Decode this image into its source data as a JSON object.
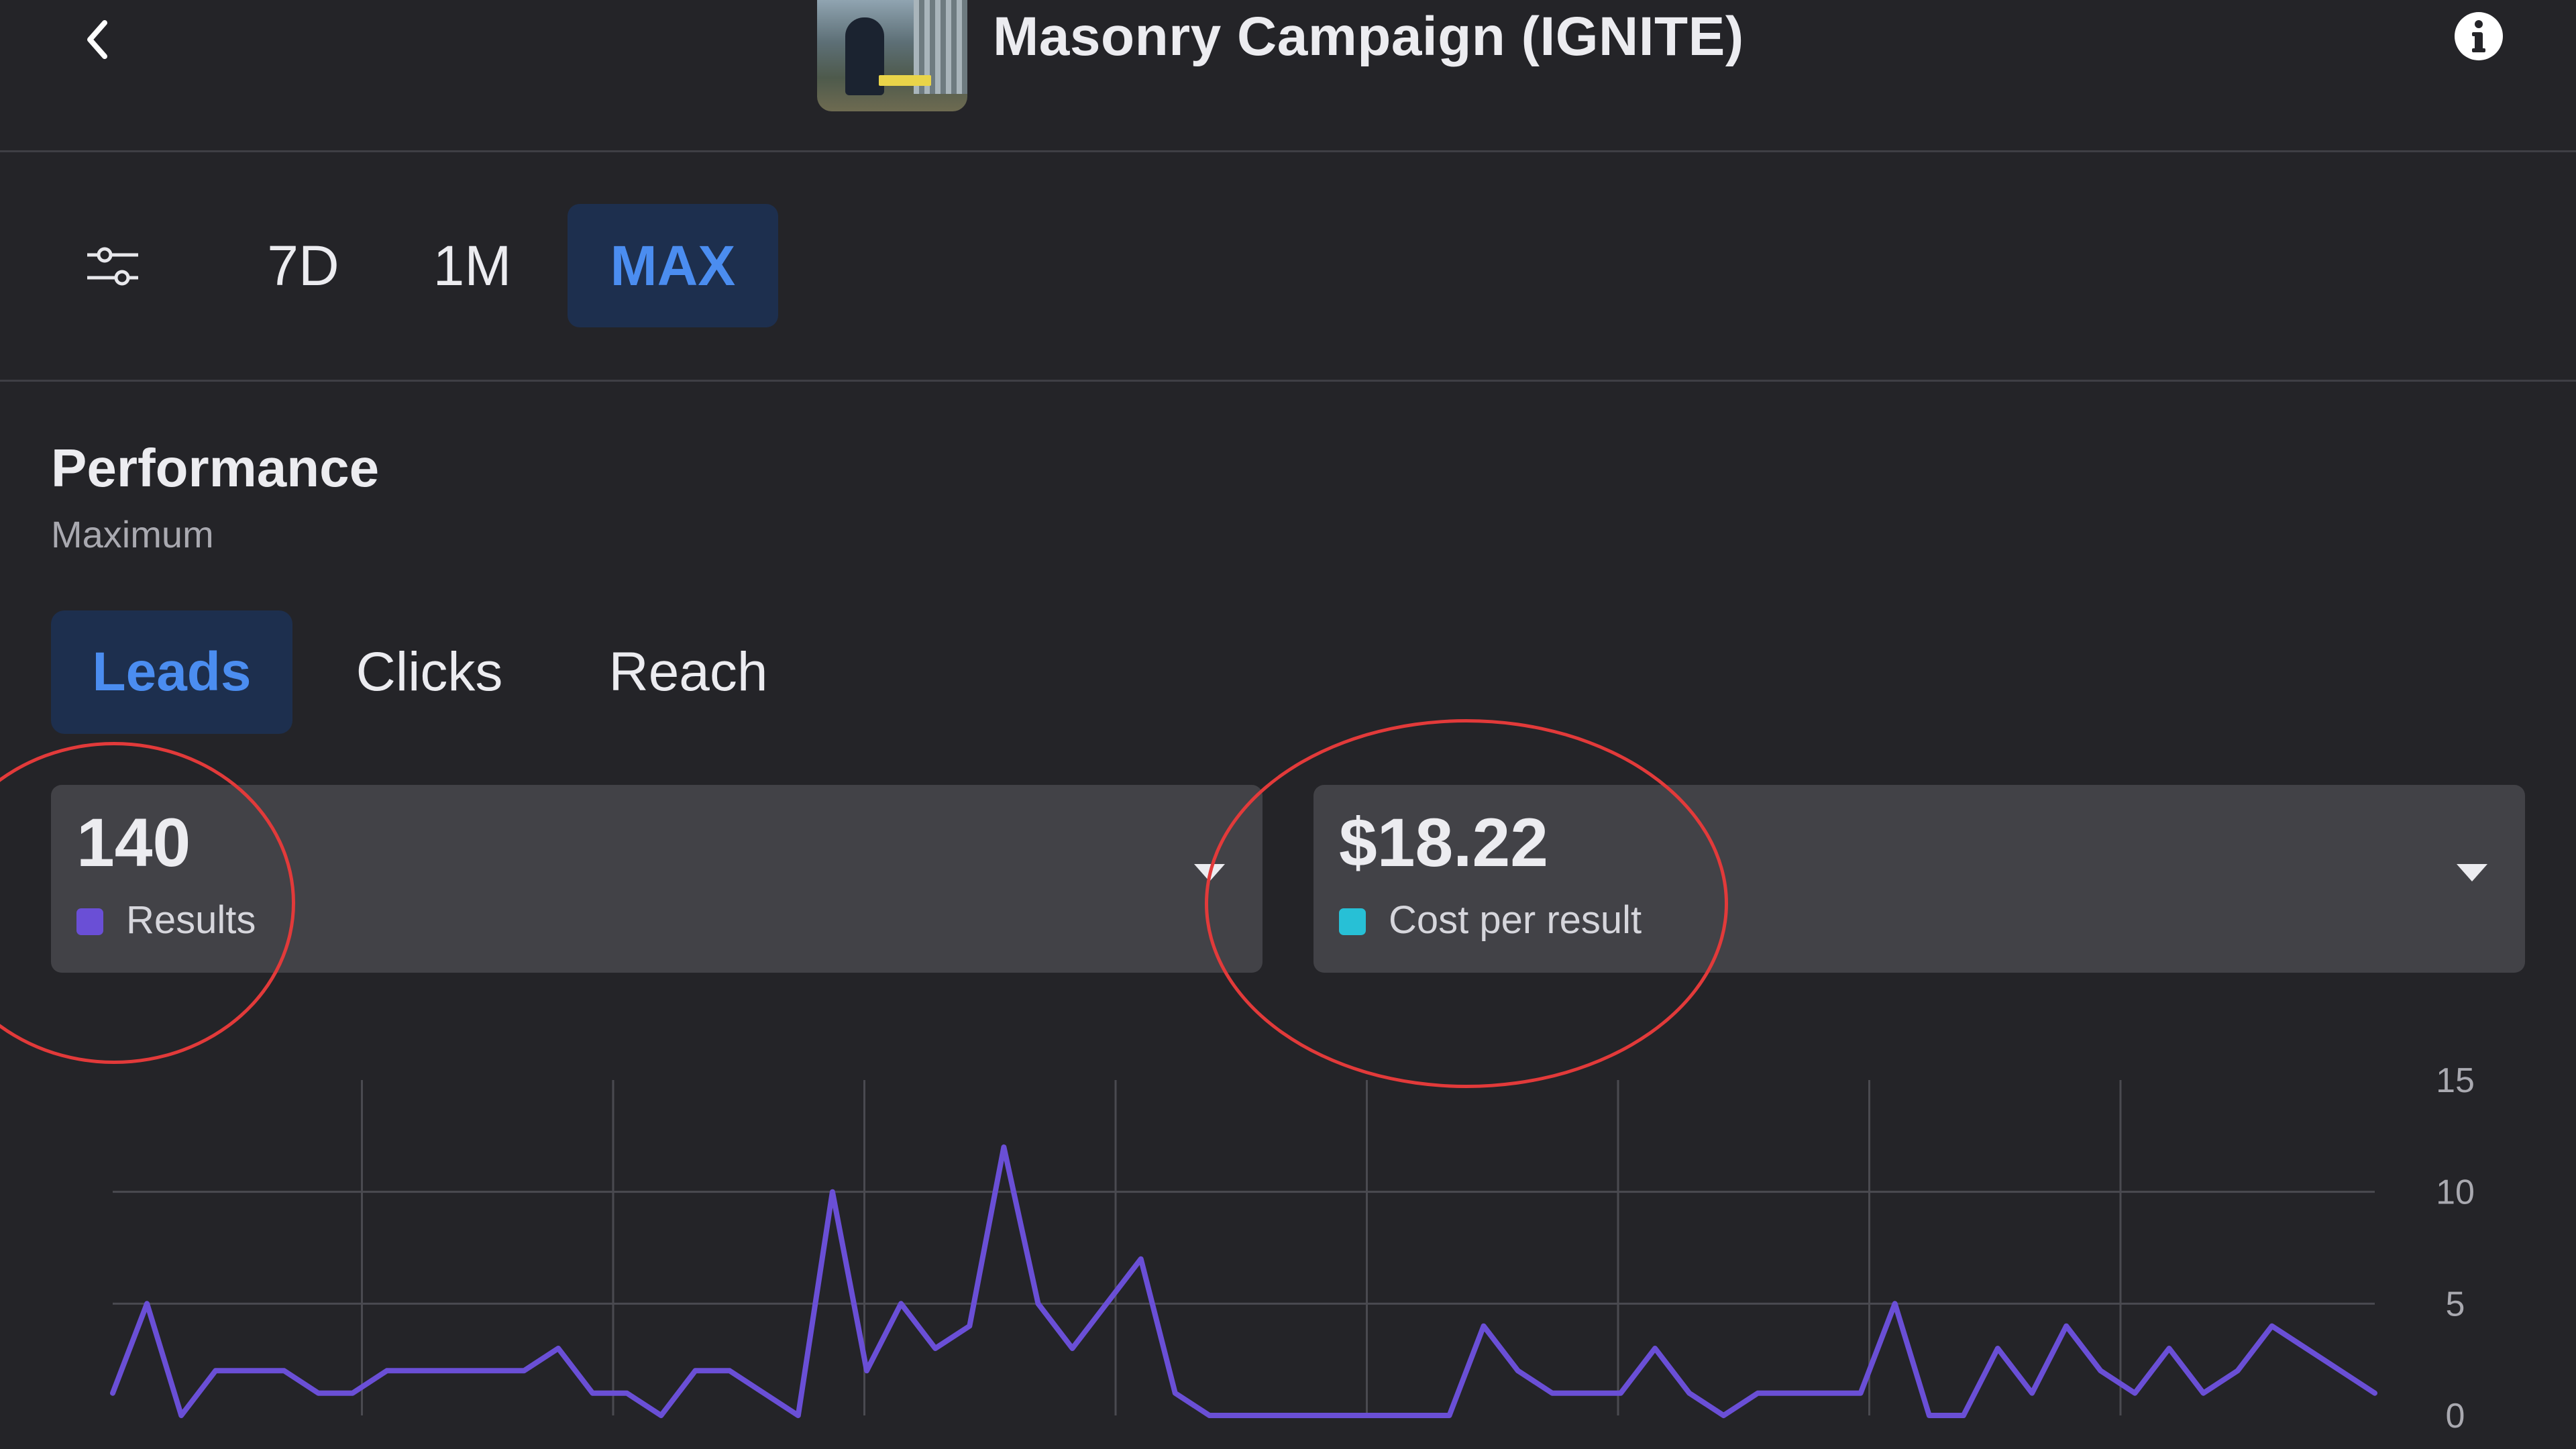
{
  "header": {
    "title": "Masonry Campaign (IGNITE)",
    "back_icon": "chevron-left-icon",
    "info_icon": "info-icon",
    "thumbnail": "campaign-thumbnail"
  },
  "range_bar": {
    "filter_icon": "sliders-icon",
    "options": [
      "7D",
      "1M",
      "MAX"
    ],
    "selected": "MAX"
  },
  "performance": {
    "title": "Performance",
    "subtitle": "Maximum",
    "tabs": [
      "Leads",
      "Clicks",
      "Reach"
    ],
    "selected_tab": "Leads"
  },
  "cards": [
    {
      "value": "140",
      "label": "Results",
      "color": "#6a4fd6"
    },
    {
      "value": "$18.22",
      "label": "Cost per result",
      "color": "#27c0d6"
    }
  ],
  "colors": {
    "background": "#242428",
    "accent": "#4b8df0",
    "series": "#6a4fd6",
    "annotation": "#e23a3a"
  },
  "chart_data": {
    "type": "line",
    "ylim": [
      0,
      15
    ],
    "yticks": [
      0,
      5,
      10,
      15
    ],
    "grid": true,
    "series": [
      {
        "name": "Results",
        "values": [
          1,
          5,
          0,
          2,
          2,
          2,
          1,
          1,
          2,
          2,
          2,
          2,
          2,
          3,
          1,
          1,
          0,
          2,
          2,
          1,
          0,
          10,
          2,
          5,
          3,
          4,
          12,
          5,
          3,
          5,
          7,
          1,
          0,
          0,
          0,
          0,
          0,
          0,
          0,
          0,
          4,
          2,
          1,
          1,
          1,
          3,
          1,
          0,
          1,
          1,
          1,
          1,
          5,
          0,
          0,
          3,
          1,
          4,
          2,
          1,
          3,
          1,
          2,
          4,
          3,
          2,
          1
        ]
      }
    ]
  }
}
